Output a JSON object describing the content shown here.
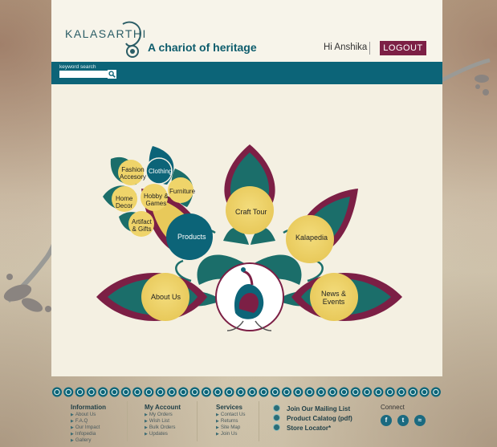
{
  "brand": {
    "logo_text": "KALASARTHI",
    "tagline": "A chariot of heritage"
  },
  "user": {
    "greeting": "Hi Anshika",
    "logout_label": "LOGOUT"
  },
  "search": {
    "label": "keyword search",
    "placeholder": "",
    "icon": "search-icon"
  },
  "petals": {
    "fashion": "Fashion\nAccesory",
    "clothing": "Clothing",
    "home_decor": "Home\nDecor",
    "hobby": "Hobby &\nGames",
    "furniture": "Furniture",
    "artifact": "Artifact\n& Gifts",
    "products": "Products",
    "craft_tour": "Craft Tour",
    "kalapedia": "Kalapedia",
    "about_us": "About Us",
    "news_events": "News &\nEvents"
  },
  "footer": {
    "information": {
      "title": "Information",
      "items": [
        "About Us",
        "F.A.Q",
        "Our Impact",
        "Infopedia",
        "Gallery"
      ]
    },
    "my_account": {
      "title": "My Account",
      "items": [
        "My Orders",
        "Wish List",
        "Bulk Orders",
        "Updates"
      ]
    },
    "services": {
      "title": "Services",
      "items": [
        "Contact Us",
        "Returns",
        "Site Map",
        "Join Us"
      ]
    },
    "links": [
      "Join Our Mailing List",
      "Product Calatog (pdf)",
      "Store Locator*"
    ],
    "connect": {
      "title": "Connect",
      "icons": [
        "facebook-icon",
        "twitter-icon",
        "rss-icon"
      ],
      "glyphs": [
        "f",
        "t",
        "≈"
      ]
    }
  },
  "colors": {
    "teal": "#0c6478",
    "maroon": "#7c1f45",
    "yellow": "#efd46a",
    "page_bg": "#f4f0e2"
  }
}
